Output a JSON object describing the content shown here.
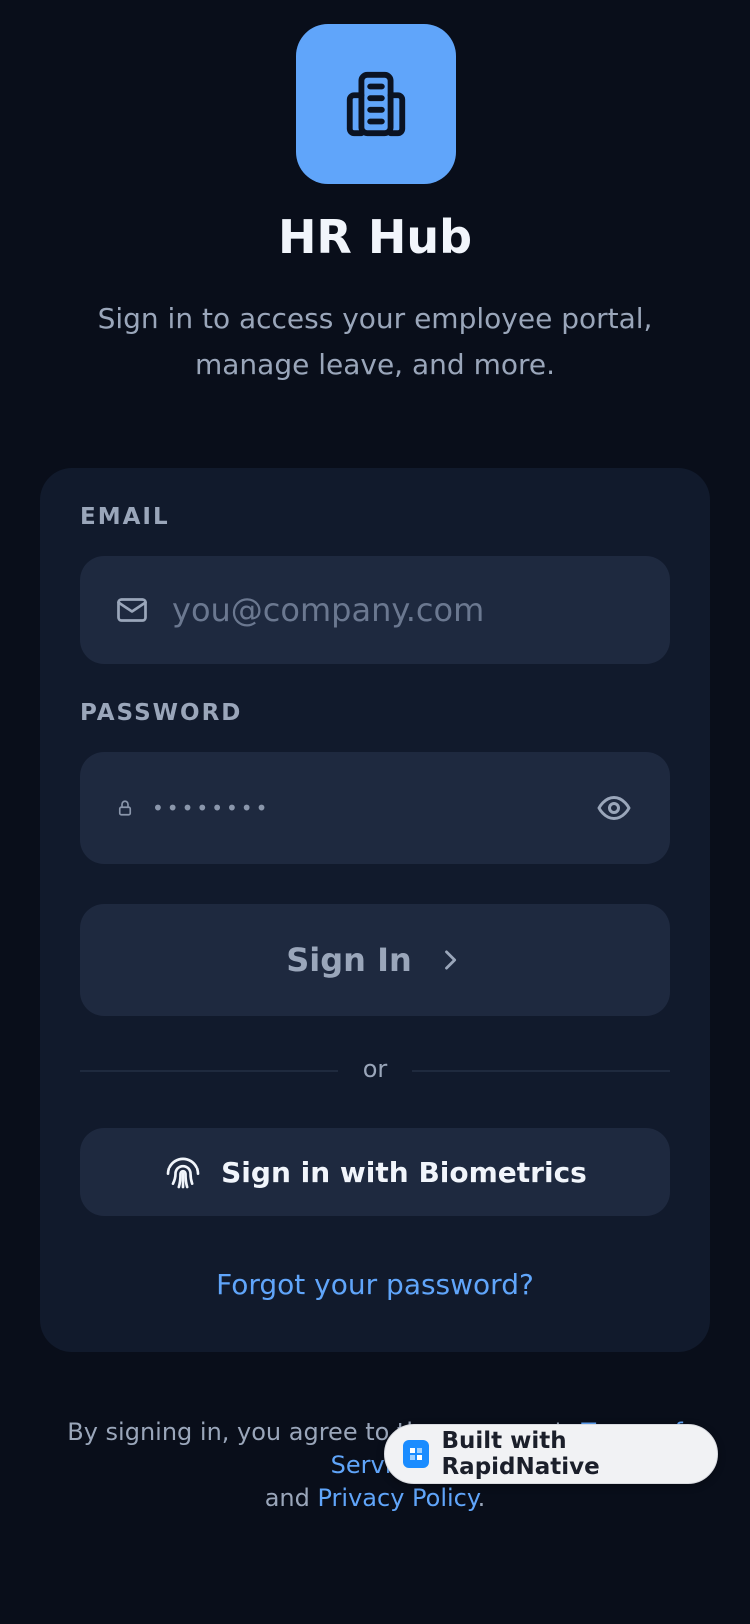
{
  "app": {
    "title": "HR Hub",
    "subtitle": "Sign in to access your employee portal, manage leave, and more.",
    "logo_icon": "building-icon"
  },
  "form": {
    "email_label": "EMAIL",
    "email_placeholder": "you@company.com",
    "email_value": "",
    "password_label": "PASSWORD",
    "password_masked": "••••••••",
    "sign_in_label": "Sign In",
    "divider_text": "or",
    "biometrics_label": "Sign in with Biometrics",
    "forgot_label": "Forgot your password?"
  },
  "legal": {
    "prefix": "By signing in, you agree to the company's",
    "terms_label": "Terms of Service",
    "and_label": "and",
    "privacy_label": "Privacy Policy",
    "suffix": "."
  },
  "badge": {
    "label": "Built with RapidNative"
  },
  "colors": {
    "background": "#090e1a",
    "card": "#111a2c",
    "input": "#1e293f",
    "accent": "#60a5fa"
  }
}
